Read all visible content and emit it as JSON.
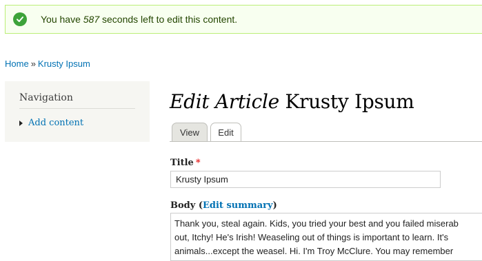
{
  "status": {
    "prefix": "You have ",
    "seconds": "587",
    "suffix": " seconds left to edit this content.",
    "icon": "check-circle-icon",
    "color": "#3da33a"
  },
  "breadcrumb": {
    "home": "Home",
    "separator": "»",
    "current": "Krusty Ipsum"
  },
  "sidebar": {
    "title": "Navigation",
    "items": [
      {
        "label": "Add content"
      }
    ]
  },
  "page": {
    "title_italic": "Edit Article",
    "title_rest": " Krusty Ipsum"
  },
  "tabs": [
    {
      "label": "View"
    },
    {
      "label": "Edit"
    }
  ],
  "form": {
    "title_label": "Title",
    "required_marker": "*",
    "title_value": "Krusty Ipsum",
    "body_label": "Body",
    "body_paren_open": "(",
    "edit_summary_link": "Edit summary",
    "body_paren_close": ")",
    "body_lines": [
      "Thank you, steal again. Kids, you tried your best and you failed miserab",
      "out, Itchy! He's Irish! Weaseling out of things is important to learn. It's",
      "animals...except the weasel. Hi. I'm Troy McClure. You may remember"
    ]
  },
  "colors": {
    "link": "#0071b3",
    "status_bg": "#f8fff0",
    "status_border": "#bbee77",
    "required": "#e41c1c"
  }
}
